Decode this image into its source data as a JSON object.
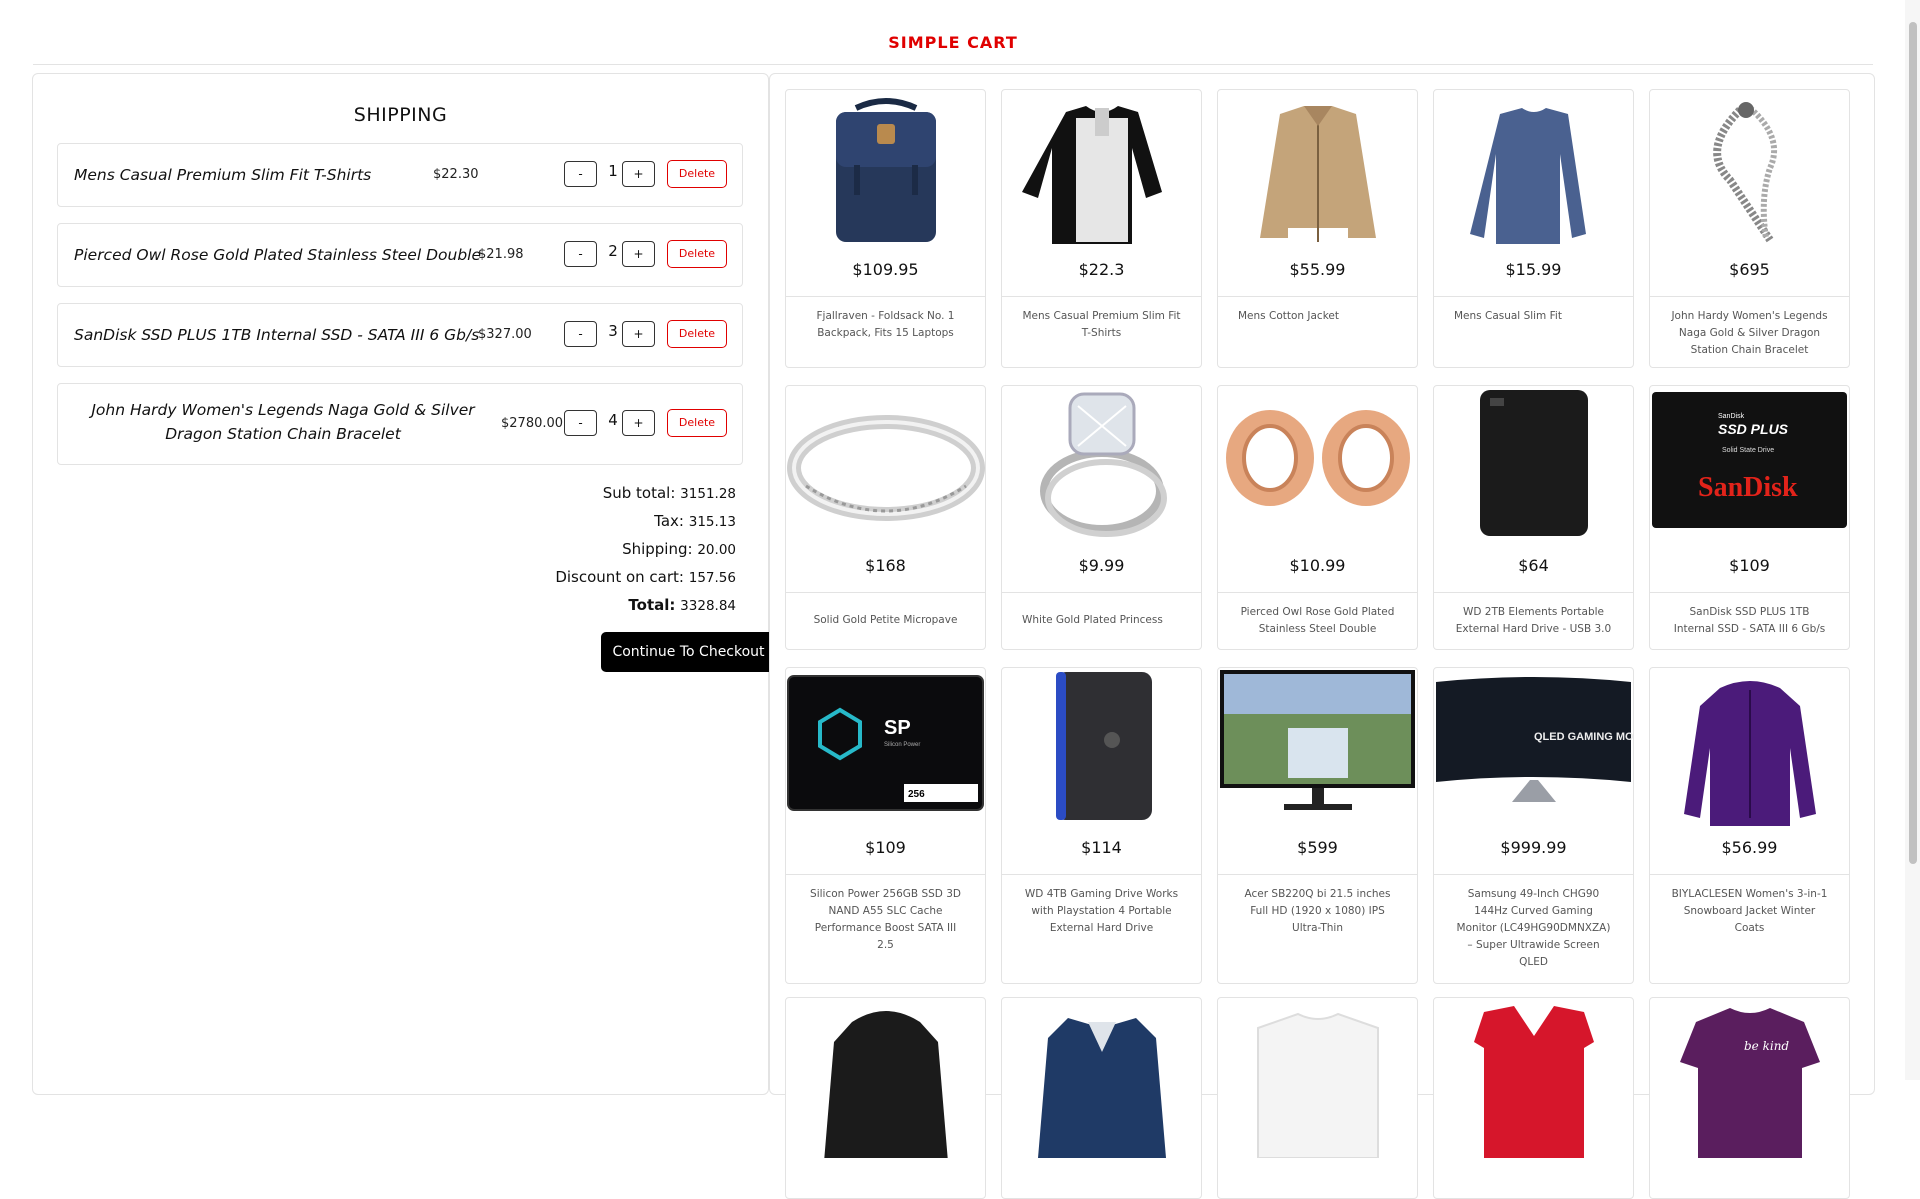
{
  "app": {
    "brand": "SIMPLE CART"
  },
  "cart": {
    "title": "SHIPPING",
    "items": [
      {
        "name": "Mens Casual Premium Slim Fit T-Shirts",
        "price": "$22.30",
        "qty": "1",
        "minus": "-",
        "plus": "+",
        "delete": "Delete"
      },
      {
        "name": "Pierced Owl Rose Gold Plated Stainless Steel Double",
        "price": "$21.98",
        "qty": "2",
        "minus": "-",
        "plus": "+",
        "delete": "Delete"
      },
      {
        "name": "SanDisk SSD PLUS 1TB Internal SSD - SATA III 6 Gb/s",
        "price": "$327.00",
        "qty": "3",
        "minus": "-",
        "plus": "+",
        "delete": "Delete"
      },
      {
        "name": "John Hardy Women's Legends Naga Gold & Silver Dragon Station Chain Bracelet",
        "price": "$2780.00",
        "qty": "4",
        "minus": "-",
        "plus": "+",
        "delete": "Delete"
      }
    ],
    "summary": {
      "subtotal_label": "Sub total:",
      "subtotal": "3151.28",
      "tax_label": "Tax:",
      "tax": "315.13",
      "shipping_label": "Shipping:",
      "shipping": "20.00",
      "discount_label": "Discount on cart:",
      "discount": "157.56",
      "total_label": "Total:",
      "total": "3328.84"
    },
    "checkout_label": "Continue To Checkout"
  },
  "products": [
    {
      "price": "$109.95",
      "title": "Fjallraven - Foldsack No. 1 Backpack, Fits 15 Laptops",
      "icon": "backpack-image"
    },
    {
      "price": "$22.3",
      "title": "Mens Casual Premium Slim Fit T-Shirts",
      "icon": "tshirt-image"
    },
    {
      "price": "$55.99",
      "title": "Mens Cotton Jacket",
      "icon": "jacket-image"
    },
    {
      "price": "$15.99",
      "title": "Mens Casual Slim Fit",
      "icon": "longsleeve-image"
    },
    {
      "price": "$695",
      "title": "John Hardy Women's Legends Naga Gold & Silver Dragon Station Chain Bracelet",
      "icon": "bracelet-image"
    },
    {
      "price": "$168",
      "title": "Solid Gold Petite Micropave",
      "icon": "ring-image"
    },
    {
      "price": "$9.99",
      "title": "White Gold Plated Princess",
      "icon": "diamond-ring-image"
    },
    {
      "price": "$10.99",
      "title": "Pierced Owl Rose Gold Plated Stainless Steel Double",
      "icon": "ear-plugs-image"
    },
    {
      "price": "$64",
      "title": "WD 2TB Elements Portable External Hard Drive - USB 3.0",
      "icon": "hard-drive-image"
    },
    {
      "price": "$109",
      "title": "SanDisk SSD PLUS 1TB Internal SSD - SATA III 6 Gb/s",
      "icon": "sandisk-ssd-image"
    },
    {
      "price": "$109",
      "title": "Silicon Power 256GB SSD 3D NAND A55 SLC Cache Performance Boost SATA III 2.5",
      "icon": "sp-ssd-image"
    },
    {
      "price": "$114",
      "title": "WD 4TB Gaming Drive Works with Playstation 4 Portable External Hard Drive",
      "icon": "gaming-drive-image"
    },
    {
      "price": "$599",
      "title": "Acer SB220Q bi 21.5 inches Full HD (1920 x 1080) IPS Ultra-Thin",
      "icon": "monitor-image"
    },
    {
      "price": "$999.99",
      "title": "Samsung 49-Inch CHG90 144Hz Curved Gaming Monitor (LC49HG90DMNXZA) – Super Ultrawide Screen QLED",
      "icon": "curved-monitor-image"
    },
    {
      "price": "$56.99",
      "title": "BIYLACLESEN Women's 3-in-1 Snowboard Jacket Winter Coats",
      "icon": "snowboard-jacket-image"
    },
    {
      "price": "",
      "title": "",
      "icon": "leather-jacket-image"
    },
    {
      "price": "",
      "title": "",
      "icon": "rain-jacket-image"
    },
    {
      "price": "",
      "title": "",
      "icon": "white-tee-image"
    },
    {
      "price": "",
      "title": "",
      "icon": "red-vneck-image"
    },
    {
      "price": "",
      "title": "",
      "icon": "purple-tee-image"
    }
  ],
  "product_images": {
    "sp_logo": "SP",
    "sp_subtitle": "Silicon Power",
    "sp_capacity": "256",
    "sandisk_small": "SanDisk",
    "sandisk_ssd_plus": "SSD PLUS",
    "sandisk_solid_state": "Solid State Drive",
    "sandisk_logo": "SanDisk",
    "qled_monitor_text": "QLED GAMING MONITOR",
    "be_kind": "be kind"
  },
  "colors": {
    "accent": "#e00000",
    "button_dark": "#000000"
  }
}
